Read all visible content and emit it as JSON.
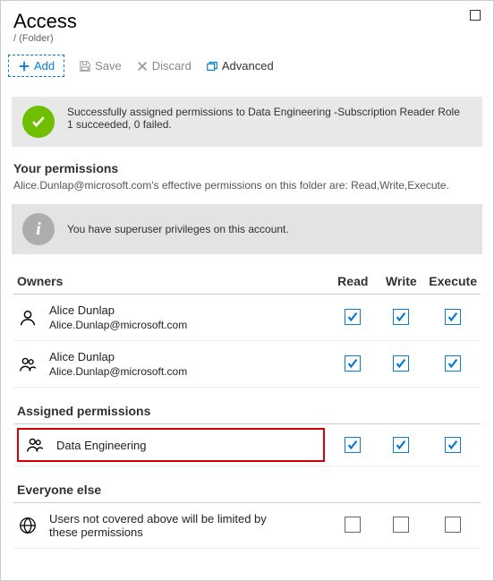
{
  "header": {
    "title": "Access",
    "breadcrumb": "/ (Folder)"
  },
  "toolbar": {
    "add": "Add",
    "save": "Save",
    "discard": "Discard",
    "advanced": "Advanced"
  },
  "success": {
    "line1": "Successfully assigned permissions to Data Engineering -Subscription Reader Role",
    "line2": "1 succeeded, 0 failed."
  },
  "your_permissions": {
    "title": "Your permissions",
    "subtitle": "Alice.Dunlap@microsoft.com's effective permissions on this folder are: Read,Write,Execute.",
    "info": "You have superuser privileges on this account."
  },
  "columns": {
    "c0": "Owners",
    "c1": "Read",
    "c2": "Write",
    "c3": "Execute"
  },
  "owners": [
    {
      "name": "Alice Dunlap",
      "sub": "Alice.Dunlap@microsoft.com"
    },
    {
      "name": "Alice Dunlap",
      "sub": "Alice.Dunlap@microsoft.com"
    }
  ],
  "assigned": {
    "title": "Assigned permissions",
    "item": "Data Engineering"
  },
  "everyone": {
    "title": "Everyone else",
    "desc": "Users not covered above will be limited by these permissions"
  }
}
